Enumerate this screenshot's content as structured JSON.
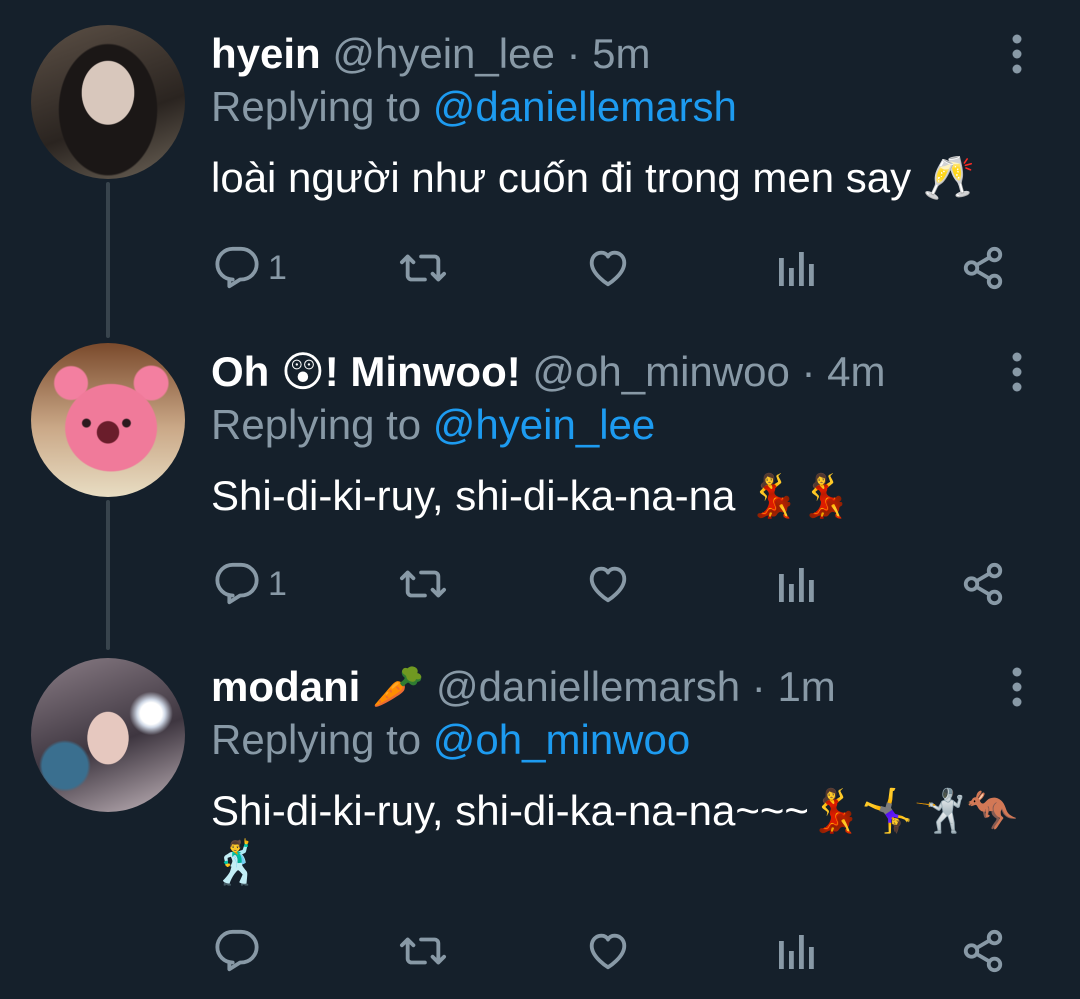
{
  "tweets": [
    {
      "display_name": "hyein",
      "handle": "@hyein_lee",
      "separator": "·",
      "time": "5m",
      "replying_prefix": "Replying to",
      "replying_to": "@daniellemarsh",
      "text": "loài người như cuốn đi trong men say 🥂",
      "reply_count": "1",
      "avatar_icon": "avatar-photo"
    },
    {
      "display_name": "Oh 😲! Minwoo!",
      "handle": "@oh_minwoo",
      "separator": "·",
      "time": "4m",
      "replying_prefix": "Replying to",
      "replying_to": "@hyein_lee",
      "text": "Shi-di-ki-ruy, shi-di-ka-na-na 💃💃",
      "reply_count": "1",
      "avatar_icon": "avatar-photo"
    },
    {
      "display_name": "modani 🥕",
      "handle": "@daniellemarsh",
      "separator": "·",
      "time": "1m",
      "replying_prefix": "Replying to",
      "replying_to": "@oh_minwoo",
      "text": "Shi-di-ki-ruy, shi-di-ka-na-na~~~💃🤸‍♀️🤺🦘🕺",
      "reply_count": "",
      "avatar_icon": "avatar-photo"
    }
  ],
  "icons": {
    "reply": "reply-icon",
    "retweet": "retweet-icon",
    "like": "heart-icon",
    "views": "analytics-icon",
    "share": "share-icon",
    "more": "more-vertical-icon"
  },
  "colors": {
    "background": "#15202b",
    "primary_text": "#ffffff",
    "secondary_text": "#8899a6",
    "link": "#1d9bf0",
    "thread_line": "#38444d"
  }
}
